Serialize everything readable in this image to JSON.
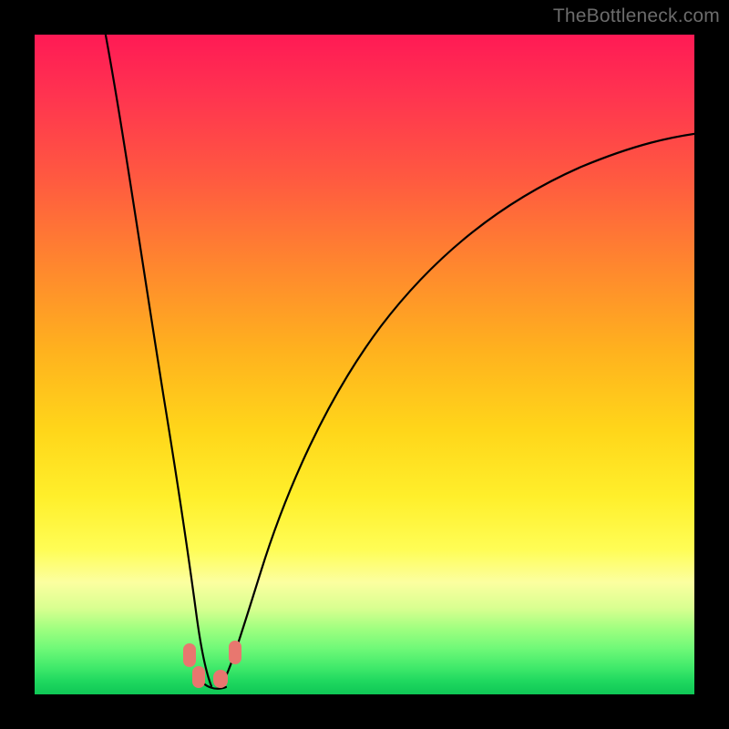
{
  "watermark": "TheBottleneck.com",
  "colors": {
    "frame": "#000000",
    "curve": "#000000",
    "marker": "#e8776f",
    "gradient_top": "#ff1a55",
    "gradient_bottom": "#0fc756"
  },
  "chart_data": {
    "type": "line",
    "title": "",
    "xlabel": "",
    "ylabel": "",
    "xlim": [
      0,
      100
    ],
    "ylim": [
      0,
      100
    ],
    "note": "Axes are unlabeled; values are relative percentages read off position. Lower y = better (green). Curve slices are the two branches of a V-shaped bottleneck profile.",
    "series": [
      {
        "name": "left-branch",
        "x": [
          10.5,
          12,
          14,
          16,
          18,
          20,
          22,
          23.5,
          25,
          26.5
        ],
        "y": [
          100,
          88,
          72,
          56,
          41,
          27,
          15,
          8,
          3,
          1
        ]
      },
      {
        "name": "right-branch",
        "x": [
          28.5,
          30,
          32,
          35,
          40,
          46,
          54,
          64,
          76,
          90,
          100
        ],
        "y": [
          1,
          4,
          10,
          20,
          34,
          47,
          58,
          68,
          76,
          82,
          85
        ]
      }
    ],
    "markers": [
      {
        "name": "valley-left",
        "x": 23.0,
        "y": 6
      },
      {
        "name": "valley-floor-1",
        "x": 25.0,
        "y": 1.5
      },
      {
        "name": "valley-floor-2",
        "x": 28.5,
        "y": 1.5
      },
      {
        "name": "valley-right",
        "x": 30.5,
        "y": 6
      }
    ]
  }
}
